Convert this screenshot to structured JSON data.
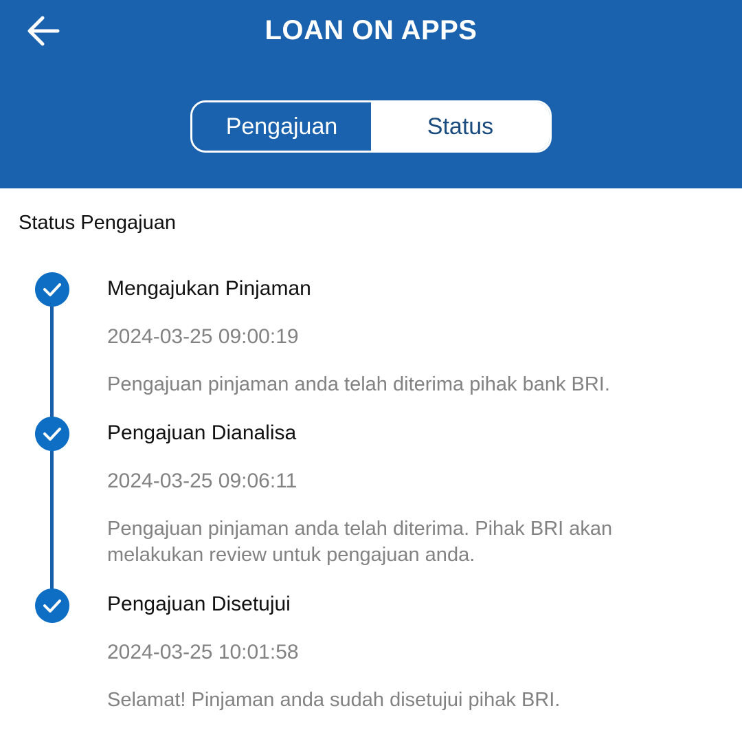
{
  "header": {
    "title": "LOAN ON APPS",
    "tabs": [
      {
        "label": "Pengajuan"
      },
      {
        "label": "Status"
      }
    ]
  },
  "section": {
    "title": "Status Pengajuan"
  },
  "steps": [
    {
      "title": "Mengajukan Pinjaman",
      "time": "2024-03-25 09:00:19",
      "desc": "Pengajuan pinjaman anda telah diterima pihak bank BRI."
    },
    {
      "title": "Pengajuan Dianalisa",
      "time": "2024-03-25 09:06:11",
      "desc": "Pengajuan pinjaman anda telah diterima. Pihak BRI akan melakukan review untuk pengajuan anda."
    },
    {
      "title": "Pengajuan Disetujui",
      "time": "2024-03-25 10:01:58",
      "desc": "Selamat! Pinjaman anda sudah disetujui pihak BRI."
    }
  ],
  "icons": {
    "back": "arrow-left-icon",
    "check": "check-icon"
  },
  "colors": {
    "primary": "#1a62ae",
    "dot": "#0d6ec4",
    "muted": "#828282"
  }
}
